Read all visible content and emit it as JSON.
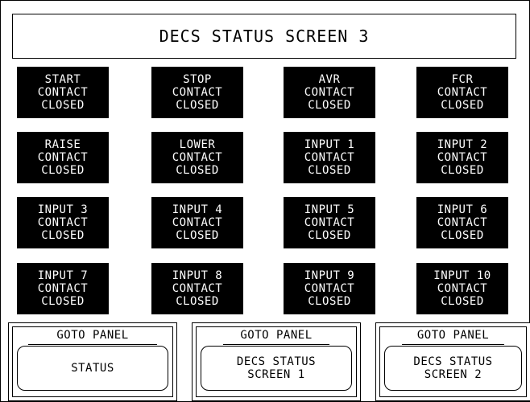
{
  "screen": {
    "title": "DECS STATUS SCREEN 3"
  },
  "contacts": [
    {
      "lines": [
        "START",
        "CONTACT",
        "CLOSED"
      ]
    },
    {
      "lines": [
        "STOP",
        "CONTACT",
        "CLOSED"
      ]
    },
    {
      "lines": [
        "AVR",
        "CONTACT",
        "CLOSED"
      ]
    },
    {
      "lines": [
        "FCR",
        "CONTACT",
        "CLOSED"
      ]
    },
    {
      "lines": [
        "RAISE",
        "CONTACT",
        "CLOSED"
      ]
    },
    {
      "lines": [
        "LOWER",
        "CONTACT",
        "CLOSED"
      ]
    },
    {
      "lines": [
        "INPUT 1",
        "CONTACT",
        "CLOSED"
      ]
    },
    {
      "lines": [
        "INPUT 2",
        "CONTACT",
        "CLOSED"
      ]
    },
    {
      "lines": [
        "INPUT 3",
        "CONTACT",
        "CLOSED"
      ]
    },
    {
      "lines": [
        "INPUT 4",
        "CONTACT",
        "CLOSED"
      ]
    },
    {
      "lines": [
        "INPUT 5",
        "CONTACT",
        "CLOSED"
      ]
    },
    {
      "lines": [
        "INPUT 6",
        "CONTACT",
        "CLOSED"
      ]
    },
    {
      "lines": [
        "INPUT 7",
        "CONTACT",
        "CLOSED"
      ]
    },
    {
      "lines": [
        "INPUT 8",
        "CONTACT",
        "CLOSED"
      ]
    },
    {
      "lines": [
        "INPUT 9",
        "CONTACT",
        "CLOSED"
      ]
    },
    {
      "lines": [
        "INPUT 10",
        "CONTACT",
        "CLOSED"
      ]
    }
  ],
  "nav": [
    {
      "goto_label": "GOTO PANEL",
      "target_lines": [
        "STATUS"
      ]
    },
    {
      "goto_label": "GOTO PANEL",
      "target_lines": [
        "DECS STATUS",
        "SCREEN 1"
      ]
    },
    {
      "goto_label": "GOTO PANEL",
      "target_lines": [
        "DECS STATUS",
        "SCREEN 2"
      ]
    }
  ],
  "colors": {
    "background": "#ffffff",
    "tile_fill": "#000000",
    "tile_text": "#ffffff",
    "border": "#000000"
  }
}
